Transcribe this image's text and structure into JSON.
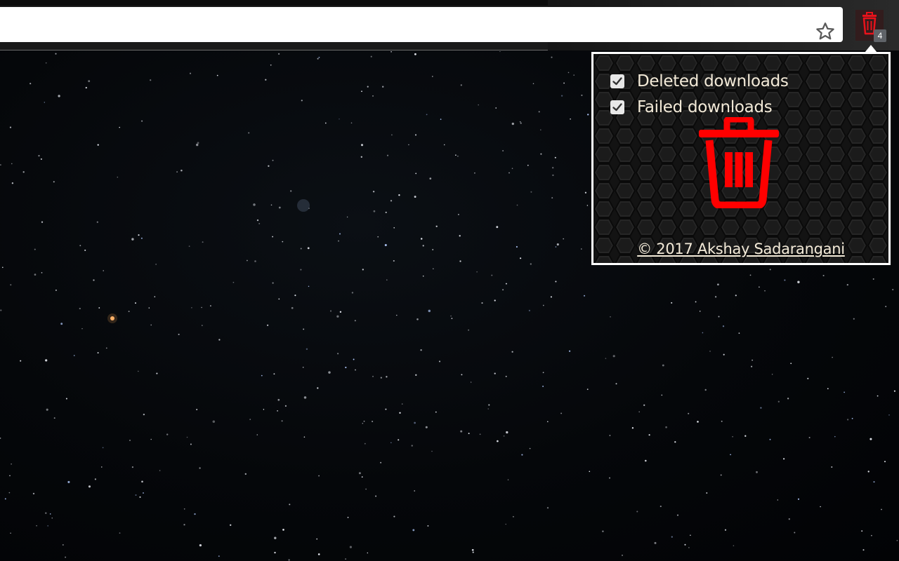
{
  "browser": {
    "omnibox": {
      "value": "",
      "placeholder": ""
    },
    "bookmark_icon": "star-outline-icon",
    "extension": {
      "icon": "trash-icon",
      "badge": "4",
      "accent": "#e8121b"
    }
  },
  "popup": {
    "options": [
      {
        "label": "Deleted downloads",
        "checked": true
      },
      {
        "label": "Failed downloads",
        "checked": true
      }
    ],
    "main_icon": "trash-icon",
    "icon_color": "#ff0000",
    "credit": "© 2017 Akshay Sadarangani"
  },
  "page": {
    "background": "starry-night-sky"
  }
}
